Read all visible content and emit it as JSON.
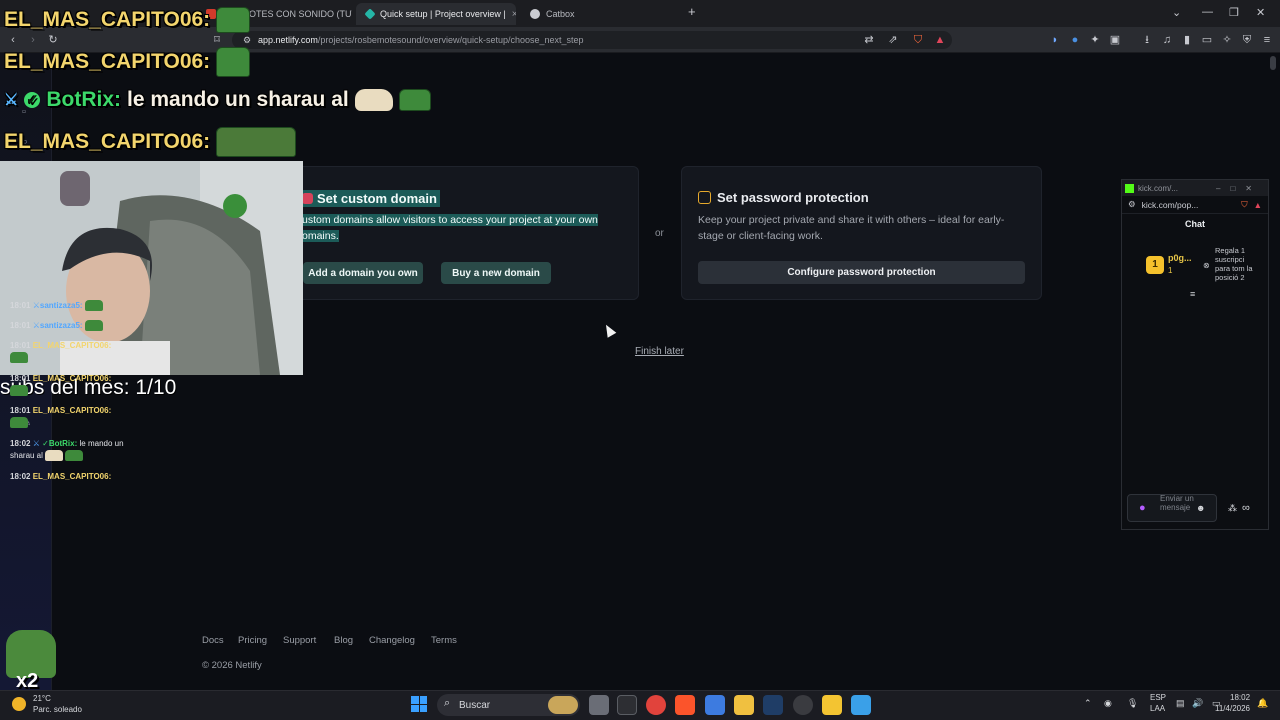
{
  "browser": {
    "tabs": [
      {
        "label": "(4) EMOTES CON SONIDO (TUTO",
        "active": false
      },
      {
        "label": "Quick setup | Project overview | ",
        "active": true
      },
      {
        "label": "Catbox",
        "active": false
      }
    ],
    "url_host": "app.netlify.com",
    "url_path": "/projects/rosbemotesound/overview/quick-setup/choose_next_step"
  },
  "overlay_chat": {
    "lines": [
      {
        "user": "EL_MAS_CAPITO06:",
        "text": ""
      },
      {
        "user": "EL_MAS_CAPITO06:",
        "text": ""
      },
      {
        "user": "BotRix:",
        "text": "le mando un sharau al"
      },
      {
        "user": "EL_MAS_CAPITO06:",
        "text": ""
      }
    ],
    "subs": "subs del mes: 1/10",
    "multiplier": "x2"
  },
  "cards": {
    "domain": {
      "title": "Set custom domain",
      "desc": "ustom domains allow visitors to access your project at your own omains.",
      "btn_add": "Add a domain you own",
      "btn_buy": "Buy a new domain"
    },
    "or": "or",
    "password": {
      "title": "Set password protection",
      "desc": "Keep your project private and share it with others – ideal for early-stage or client-facing work.",
      "btn": "Configure password protection"
    }
  },
  "finish_later": "Finish later",
  "footer": {
    "links": [
      "Docs",
      "Pricing",
      "Support",
      "Blog",
      "Changelog",
      "Terms"
    ],
    "copyright": "© 2026 Netlify"
  },
  "kick": {
    "window_title": "kick.com/...",
    "url": "kick.com/pop...",
    "chat_header": "Chat",
    "gift_user": "p0g...",
    "gift_count": "1",
    "gift_text": "Regala 1 suscripci para tom la posició 2",
    "messages": [
      {
        "time": "18:01",
        "user": "santizaza5:",
        "text": "",
        "kind": "u1"
      },
      {
        "time": "18:01",
        "user": "santizaza5:",
        "text": "",
        "kind": "u1"
      },
      {
        "time": "18:01",
        "user": "EL_MAS_CAPITO06:",
        "text": "",
        "kind": "u2"
      },
      {
        "time": "18:01",
        "user": "EL_MAS_CAPITO06:",
        "text": "",
        "kind": "u2"
      },
      {
        "time": "18:01",
        "user": "EL_MAS_CAPITO06:",
        "text": "",
        "kind": "u2"
      },
      {
        "time": "18:02",
        "user": "BotRix:",
        "text": "le mando un sharau al",
        "kind": "u3"
      },
      {
        "time": "18:02",
        "user": "EL_MAS_CAPITO06:",
        "text": "",
        "kind": "u2"
      }
    ],
    "input_placeholder": "Enviar un mensaje"
  },
  "taskbar": {
    "weather_temp": "21°C",
    "weather_desc": "Parc. soleado",
    "search": "Buscar",
    "lang1": "ESP",
    "lang2": "LAA",
    "time": "18:02",
    "date": "11/4/2026"
  }
}
